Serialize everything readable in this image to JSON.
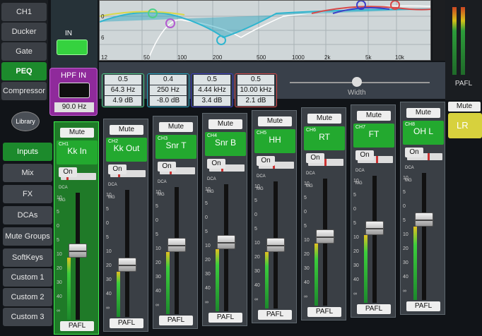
{
  "processing_tabs": [
    {
      "label": "CH1",
      "active": false
    },
    {
      "label": "Ducker",
      "active": false
    },
    {
      "label": "Gate",
      "active": false
    },
    {
      "label": "PEQ",
      "active": true
    },
    {
      "label": "Compressor",
      "active": false
    }
  ],
  "input": {
    "in_label": "IN",
    "hpf_label": "HPF IN",
    "hpf_value": "90.0 Hz"
  },
  "eq": {
    "freq_labels": [
      "50",
      "100",
      "200",
      "500",
      "1000",
      "2k",
      "5k",
      "10k"
    ],
    "db_labels": [
      "0",
      "6",
      "12"
    ],
    "width_label": "Width",
    "bands": [
      {
        "q": "0.5",
        "freq": "64.3 Hz",
        "gain": "4.9 dB",
        "color": "#4fd08a"
      },
      {
        "q": "0.4",
        "freq": "250 Hz",
        "gain": "-8.0 dB",
        "color": "#25a7c2"
      },
      {
        "q": "0.5",
        "freq": "4.44 kHz",
        "gain": "3.4 dB",
        "color": "#3c3fc7"
      },
      {
        "q": "0.5",
        "freq": "10.00 kHz",
        "gain": "2.1 dB",
        "color": "#d84848"
      }
    ]
  },
  "master": {
    "pafl_label": "PAFL",
    "mute_label": "Mute",
    "name": "LR"
  },
  "library_label": "Library",
  "nav": [
    {
      "label": "Inputs",
      "active": true
    },
    {
      "label": "Mix",
      "active": false
    },
    {
      "label": "FX",
      "active": false
    },
    {
      "label": "DCAs",
      "active": false
    },
    {
      "label": "Mute Groups",
      "active": false
    },
    {
      "label": "SoftKeys",
      "active": false
    },
    {
      "label": "Custom 1",
      "active": false
    },
    {
      "label": "Custom 2",
      "active": false
    },
    {
      "label": "Custom 3",
      "active": false
    }
  ],
  "strip_common": {
    "mute_label": "Mute",
    "on_label": "On",
    "pafl_label": "PAFL",
    "dca_label": "DCA",
    "mg_label": "MG"
  },
  "fader_scale": [
    "10",
    "5",
    "0",
    "5",
    "10",
    "20",
    "30",
    "40",
    "∞"
  ],
  "channels": [
    {
      "num": "CH1",
      "name": "Kk In",
      "selected": true,
      "level": 0.55
    },
    {
      "num": "CH2",
      "name": "Kk Out",
      "selected": false,
      "level": 0.4
    },
    {
      "num": "CH3",
      "name": "Snr T",
      "selected": false,
      "level": 0.55
    },
    {
      "num": "CH4",
      "name": "Snr B",
      "selected": false,
      "level": 0.55
    },
    {
      "num": "CH5",
      "name": "HH",
      "selected": false,
      "level": 0.5
    },
    {
      "num": "CH6",
      "name": "RT",
      "selected": false,
      "level": 0.55
    },
    {
      "num": "CH7",
      "name": "FT",
      "selected": false,
      "level": 0.6
    },
    {
      "num": "CH8",
      "name": "OH L",
      "selected": false,
      "level": 0.65
    }
  ]
}
